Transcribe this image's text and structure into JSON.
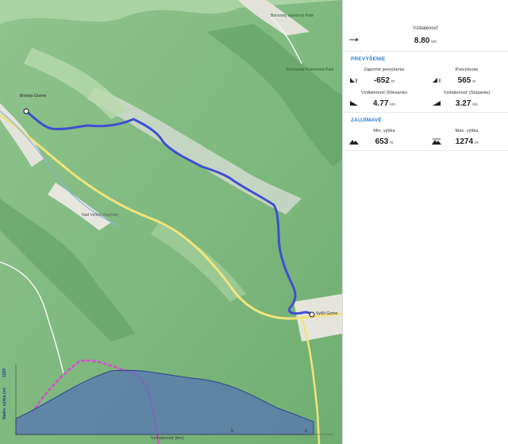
{
  "map": {
    "place_start": "Brezejs Gorme",
    "place_end": "Vyšší Gorne",
    "place_top": "Borovský kamenný Park",
    "place_mid": "Vrchovská Podzemná Park",
    "road_label": "Nad Veľkou Kopčeky"
  },
  "profile": {
    "y_axis_label": "Nadm. výška (m)",
    "y_max_tick": "1250",
    "x_axis_label": "Vzdialenosť (km)",
    "x_ticks": [
      "5",
      "8"
    ]
  },
  "summary": {
    "distance_label": "Vzdialenosť",
    "distance_value": "8.80",
    "distance_unit": "km"
  },
  "elevation": {
    "title": "PREVÝŠENIE",
    "neg_label": "Záporné prevýšenie",
    "neg_value": "-652",
    "neg_unit": "m",
    "pos_label": "Prevýšenie",
    "pos_value": "565",
    "pos_unit": "m",
    "down_dist_label": "Vzdialenosť (Klesanie)",
    "down_dist_value": "4.77",
    "down_dist_unit": "km",
    "up_dist_label": "Vzdialenosť (Stúpanie)",
    "up_dist_value": "3.27",
    "up_dist_unit": "km"
  },
  "interesting": {
    "title": "ZAUJÍMAVÉ",
    "min_label": "Min. výška",
    "min_value": "653",
    "min_unit": "m",
    "max_label": "Max. výška",
    "max_value": "1274",
    "max_unit": "m"
  },
  "colors": {
    "route": "#3f4fcf",
    "profile_fill": "#5470b8",
    "section_title": "#2a7bd0",
    "trail_magenta": "#d94cd0"
  }
}
